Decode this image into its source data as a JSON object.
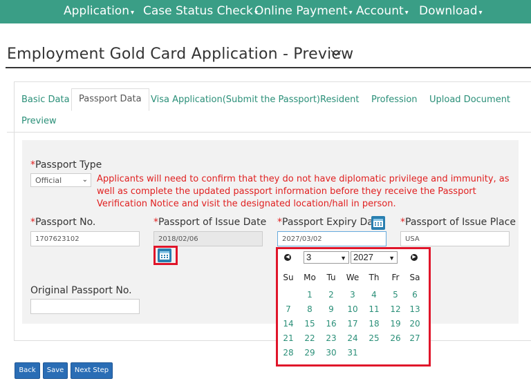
{
  "nav": {
    "items": [
      {
        "label": "Application"
      },
      {
        "label": "Case Status Check"
      },
      {
        "label": "Online Payment"
      },
      {
        "label": "Account"
      },
      {
        "label": "Download"
      }
    ],
    "caret": "▾"
  },
  "page": {
    "title": "Employment Gold Card Application - Preview"
  },
  "tabs": [
    {
      "label": "Basic Data"
    },
    {
      "label": "Passport Data",
      "active": true
    },
    {
      "label": "Visa Application(Submit the Passport)"
    },
    {
      "label": "Resident"
    },
    {
      "label": "Profession"
    },
    {
      "label": "Upload Document"
    },
    {
      "label": "Preview"
    }
  ],
  "form": {
    "required_mark": "*",
    "passport_type": {
      "label": "Passport Type",
      "value": "Official"
    },
    "warning": "Applicants will need to confirm that they do not have diplomatic privilege and immunity, as well as complete the updated passport information before they receive the Passport Verification Notice and visit the designated location/hall in person.",
    "passport_no": {
      "label": "Passport No.",
      "value": "1707623102"
    },
    "issue_date": {
      "label": "Passport of Issue Date",
      "value": "2018/02/06"
    },
    "expiry_date": {
      "label": "Passport Expiry Date",
      "value": "2027/03/02"
    },
    "issue_place": {
      "label": "Passport of Issue Place",
      "value": "USA"
    },
    "original_passport_no": {
      "label": "Original Passport No.",
      "value": ""
    }
  },
  "datepicker": {
    "month": "3",
    "year": "2027",
    "weekdays": [
      "Su",
      "Mo",
      "Tu",
      "We",
      "Th",
      "Fr",
      "Sa"
    ],
    "weeks": [
      [
        "",
        "1",
        "2",
        "3",
        "4",
        "5",
        "6"
      ],
      [
        "7",
        "8",
        "9",
        "10",
        "11",
        "12",
        "13"
      ],
      [
        "14",
        "15",
        "16",
        "17",
        "18",
        "19",
        "20"
      ],
      [
        "21",
        "22",
        "23",
        "24",
        "25",
        "26",
        "27"
      ],
      [
        "28",
        "29",
        "30",
        "31",
        "",
        "",
        ""
      ]
    ]
  },
  "buttons": {
    "back": "Back",
    "save": "Save",
    "next": "Next Step"
  },
  "colors": {
    "nav_bg": "#3a9e86",
    "accent": "#2a8f78",
    "error": "#e02020",
    "highlight": "#e0152a",
    "button": "#2a6db5"
  }
}
